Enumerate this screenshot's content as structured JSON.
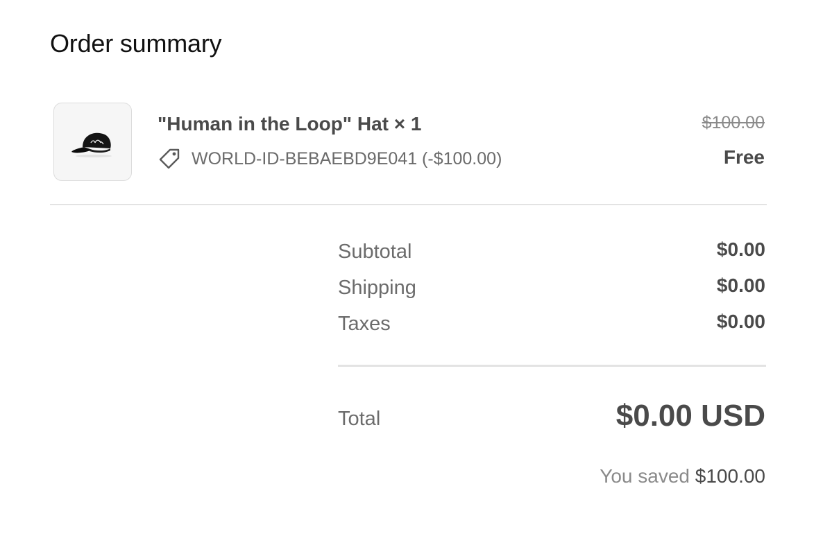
{
  "header": {
    "title": "Order summary"
  },
  "line_item": {
    "image_icon": "black-cap-icon",
    "name": "\"Human in the Loop\" Hat × 1",
    "discount_icon": "tag-icon",
    "discount_text": "WORLD-ID-BEBAEBD9E041 (-$100.00)",
    "original_price": "$100.00",
    "final_price": "Free"
  },
  "summary": {
    "rows": [
      {
        "label": "Subtotal",
        "value": "$0.00"
      },
      {
        "label": "Shipping",
        "value": "$0.00"
      },
      {
        "label": "Taxes",
        "value": "$0.00"
      }
    ],
    "total_label": "Total",
    "total_value": "$0.00 USD",
    "saved_prefix": "You saved",
    "saved_amount": "$100.00"
  }
}
